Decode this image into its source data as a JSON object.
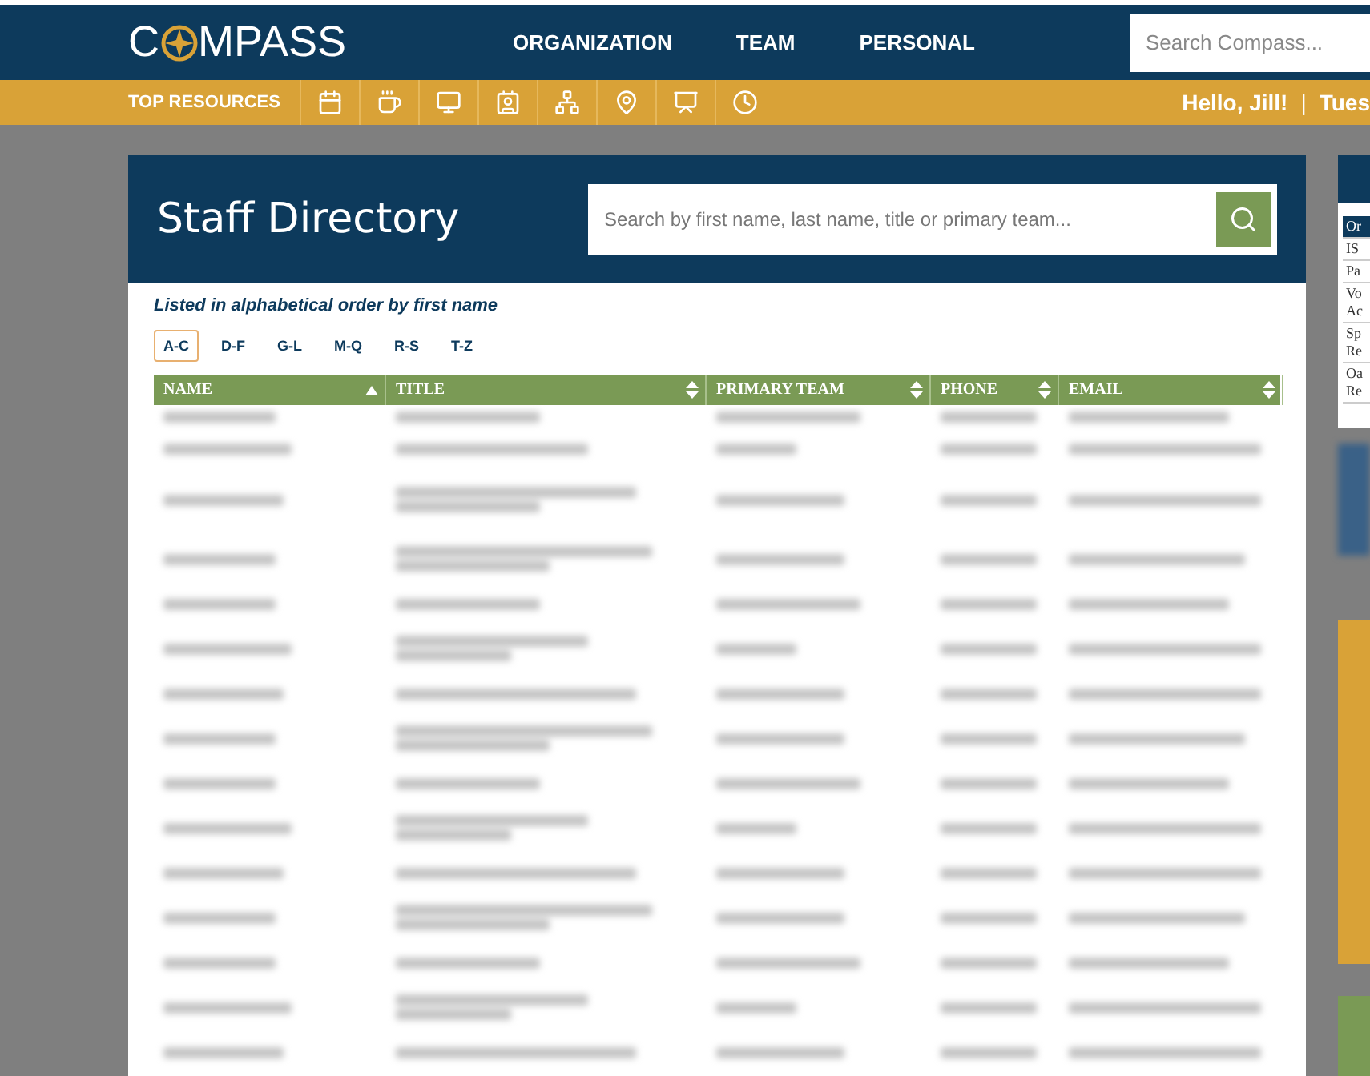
{
  "header": {
    "logo_left": "C",
    "logo_right": "MPASS",
    "nav": [
      "ORGANIZATION",
      "TEAM",
      "PERSONAL"
    ],
    "search": {
      "placeholder": "Search Compass..."
    }
  },
  "resources_bar": {
    "label": "TOP RESOURCES",
    "greeting": "Hello, Jill!",
    "separator": "|",
    "date": "Tues"
  },
  "directory": {
    "title": "Staff Directory",
    "search": {
      "placeholder": "Search by first name, last name, title or primary team..."
    },
    "note": "Listed in alphabetical order by first name",
    "letter_tabs": [
      {
        "label": "A-C",
        "selected": true
      },
      {
        "label": "D-F",
        "selected": false
      },
      {
        "label": "G-L",
        "selected": false
      },
      {
        "label": "M-Q",
        "selected": false
      },
      {
        "label": "R-S",
        "selected": false
      },
      {
        "label": "T-Z",
        "selected": false
      }
    ],
    "columns": [
      {
        "label": "NAME",
        "sorted": true
      },
      {
        "label": "TITLE",
        "sorted": false
      },
      {
        "label": "PRIMARY TEAM",
        "sorted": false
      },
      {
        "label": "PHONE",
        "sorted": false
      },
      {
        "label": "EMAIL",
        "sorted": false
      }
    ]
  },
  "side_panel": {
    "items": [
      {
        "lines": [
          "Or"
        ],
        "selected": true
      },
      {
        "lines": [
          "IS"
        ],
        "selected": false
      },
      {
        "lines": [
          "Pa"
        ],
        "selected": false
      },
      {
        "lines": [
          "Vo",
          "Ac"
        ],
        "selected": false
      },
      {
        "lines": [
          "Sp",
          "Re"
        ],
        "selected": false
      },
      {
        "lines": [
          "Oa",
          "Re"
        ],
        "selected": false
      }
    ]
  }
}
